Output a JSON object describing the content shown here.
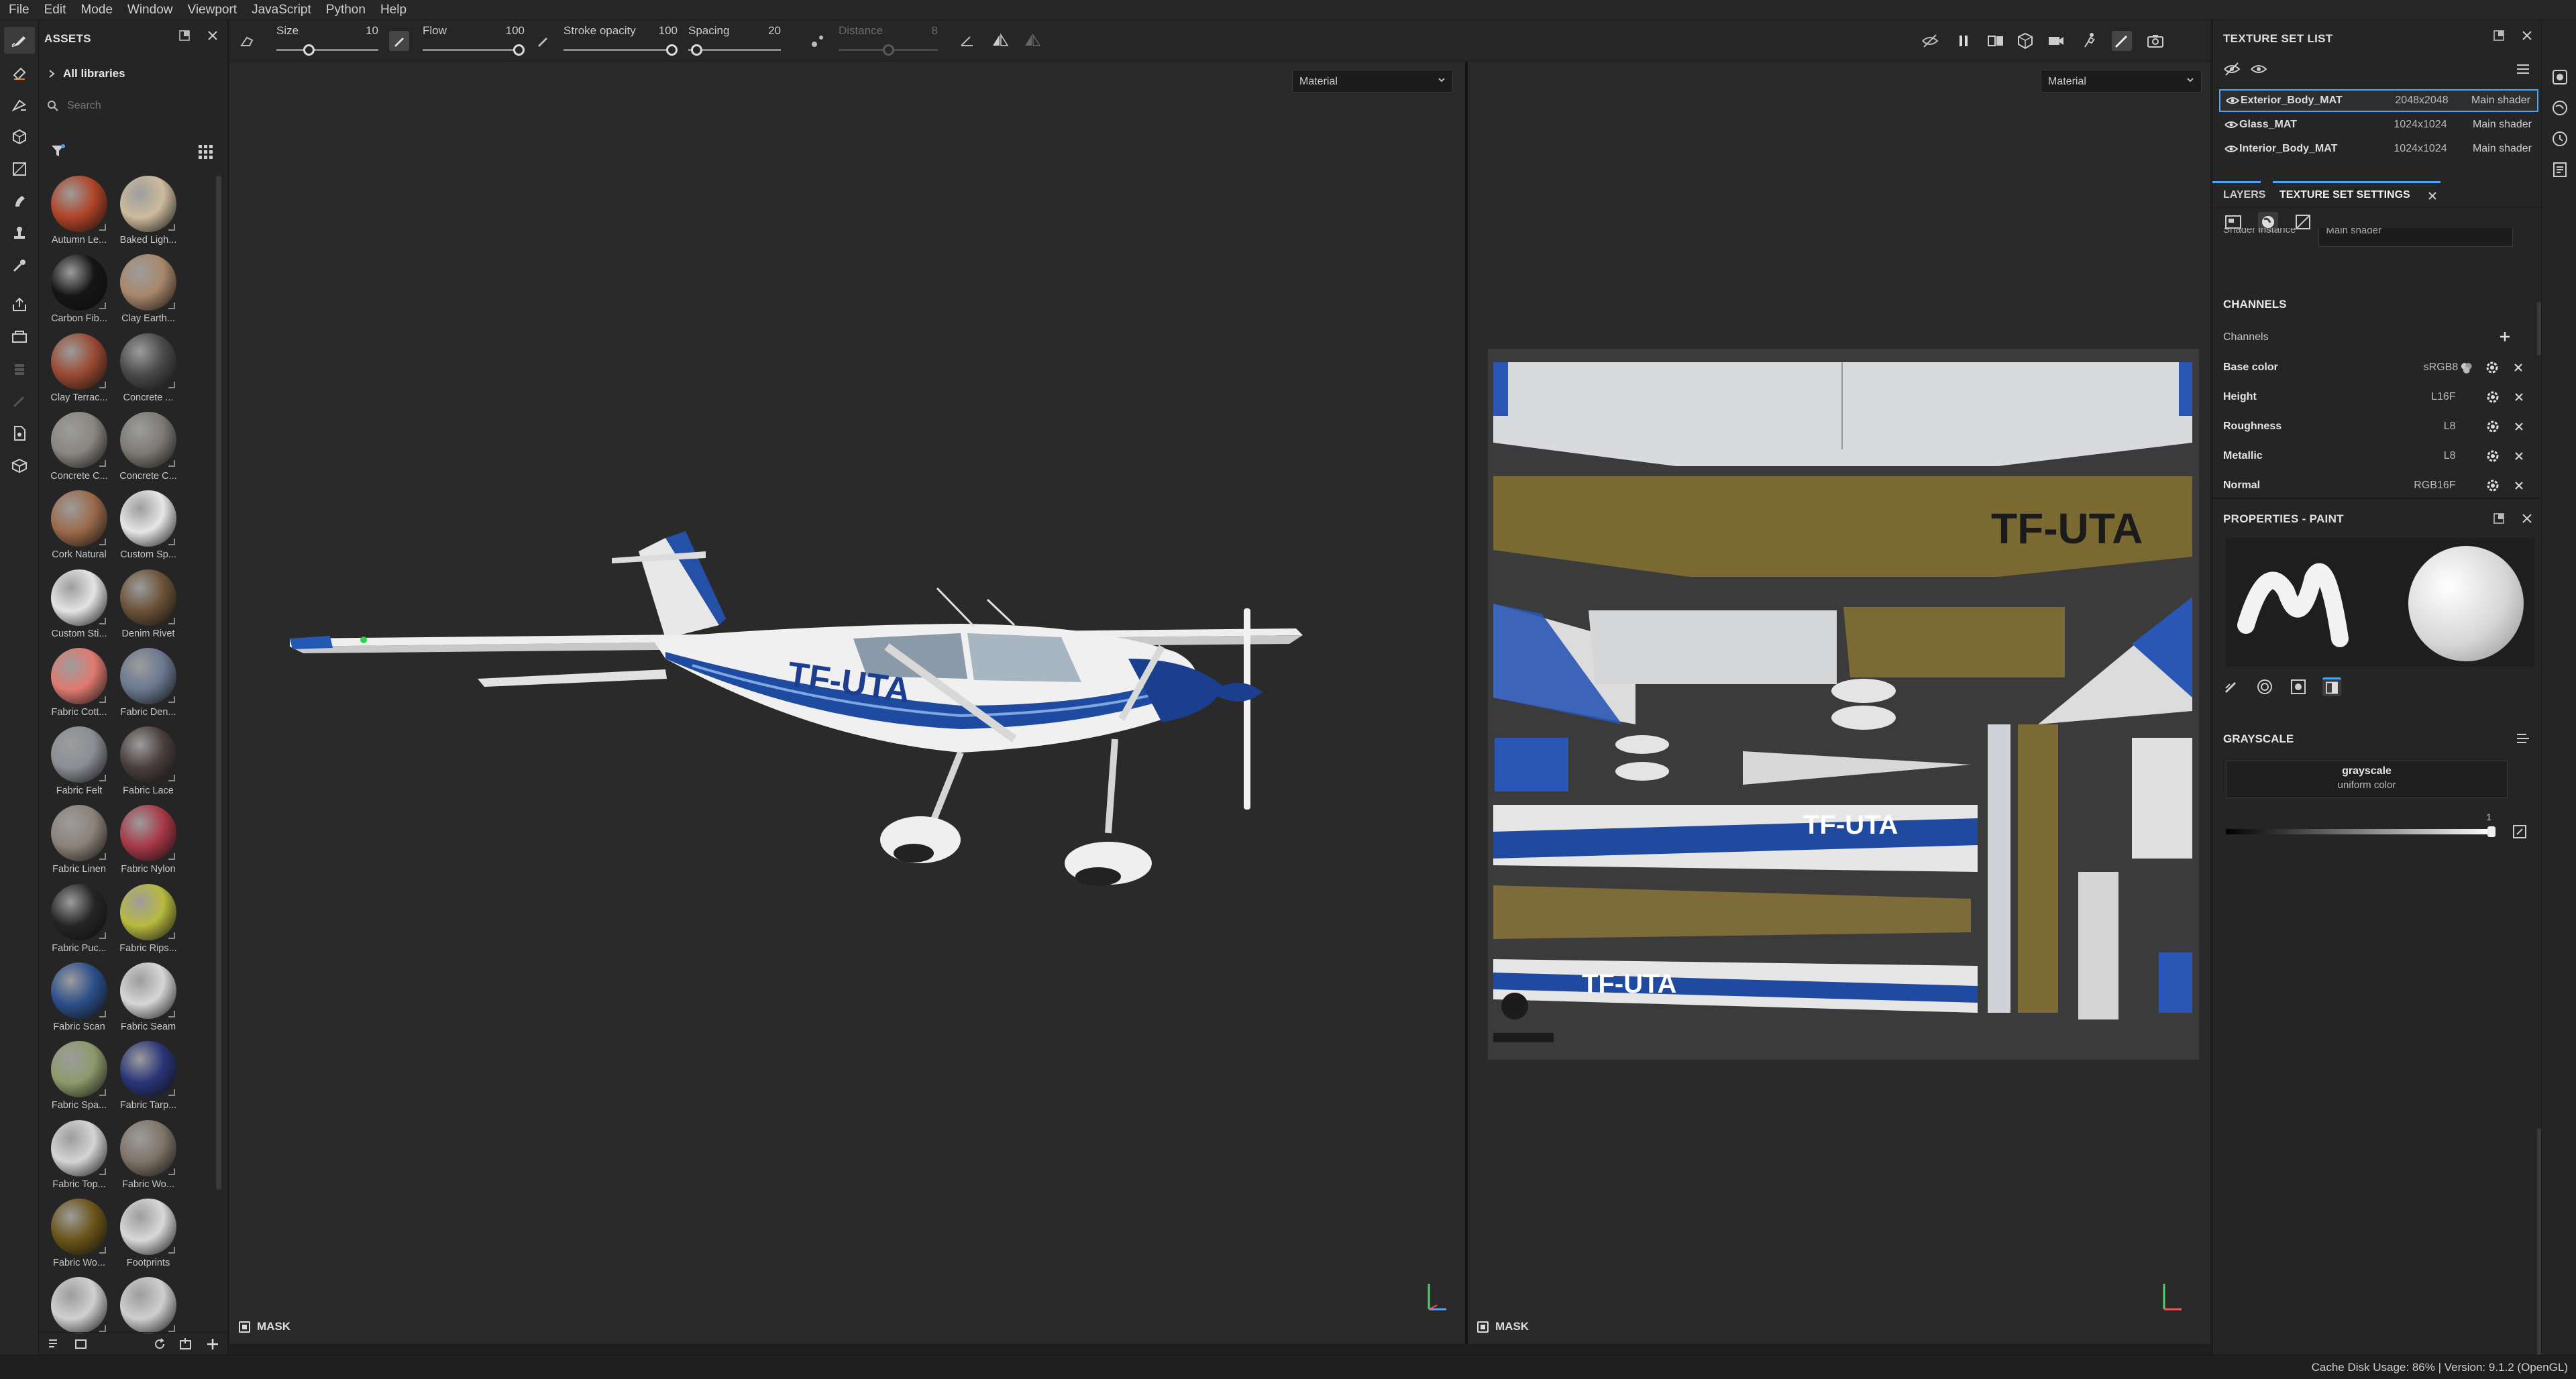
{
  "menu": [
    "File",
    "Edit",
    "Mode",
    "Window",
    "Viewport",
    "JavaScript",
    "Python",
    "Help"
  ],
  "assets": {
    "title": "ASSETS",
    "library": "All libraries",
    "search_placeholder": "Search",
    "items": [
      {
        "label": "Autumn Le...",
        "color": "#b04428"
      },
      {
        "label": "Baked Ligh...",
        "color": "#cdbb9d"
      },
      {
        "label": "Carbon Fib...",
        "color": "#151515"
      },
      {
        "label": "Clay Earth...",
        "color": "#a8876a"
      },
      {
        "label": "Clay Terrac...",
        "color": "#9a4a32"
      },
      {
        "label": "Concrete ...",
        "color": "#4a4a4a"
      },
      {
        "label": "Concrete C...",
        "color": "#8a8680"
      },
      {
        "label": "Concrete C...",
        "color": "#7d7a74"
      },
      {
        "label": "Cork Natural",
        "color": "#9b6a4a"
      },
      {
        "label": "Custom Sp...",
        "color": "#e6e6e6"
      },
      {
        "label": "Custom Sti...",
        "color": "#e4e4e4"
      },
      {
        "label": "Denim Rivet",
        "color": "#6b5238"
      },
      {
        "label": "Fabric Cott...",
        "color": "#e07a70"
      },
      {
        "label": "Fabric Den...",
        "color": "#6a7890"
      },
      {
        "label": "Fabric Felt",
        "color": "#8a8e94"
      },
      {
        "label": "Fabric Lace",
        "color": "#4a3e3e"
      },
      {
        "label": "Fabric Linen",
        "color": "#8c8278"
      },
      {
        "label": "Fabric Nylon",
        "color": "#a83848"
      },
      {
        "label": "Fabric Puc...",
        "color": "#252525"
      },
      {
        "label": "Fabric Rips...",
        "color": "#b8ba40"
      },
      {
        "label": "Fabric Scan",
        "color": "#2c4f8a"
      },
      {
        "label": "Fabric Seam",
        "color": "#d6d6d6"
      },
      {
        "label": "Fabric Spa...",
        "color": "#8e9a6c"
      },
      {
        "label": "Fabric Tarp...",
        "color": "#2a3578"
      },
      {
        "label": "Fabric Top...",
        "color": "#d4d4d4"
      },
      {
        "label": "Fabric Wo...",
        "color": "#807468"
      },
      {
        "label": "Fabric Wo...",
        "color": "#6a5418"
      },
      {
        "label": "Footprints",
        "color": "#d8d8d8"
      },
      {
        "label": "",
        "color": "#d0d0d0"
      },
      {
        "label": "",
        "color": "#cfcfcf"
      }
    ]
  },
  "toolbar": {
    "size_label": "Size",
    "size_value": "10",
    "flow_label": "Flow",
    "flow_value": "100",
    "opacity_label": "Stroke opacity",
    "opacity_value": "100",
    "spacing_label": "Spacing",
    "spacing_value": "20",
    "distance_label": "Distance",
    "distance_value": "8"
  },
  "viewport": {
    "material_left": "Material",
    "material_right": "Material",
    "mask_left": "MASK",
    "mask_right": "MASK",
    "registration": "TF-UTA"
  },
  "texture_set_list": {
    "title": "TEXTURE SET LIST",
    "rows": [
      {
        "name": "Exterior_Body_MAT",
        "res": "2048x2048",
        "shader": "Main shader"
      },
      {
        "name": "Glass_MAT",
        "res": "1024x1024",
        "shader": "Main shader"
      },
      {
        "name": "Interior_Body_MAT",
        "res": "1024x1024",
        "shader": "Main shader"
      }
    ]
  },
  "tabs": {
    "layers": "LAYERS",
    "settings": "TEXTURE SET SETTINGS"
  },
  "settings": {
    "shader_instance_label": "Shader instance",
    "shader_instance_value": "Main shader",
    "channels_title": "CHANNELS",
    "channels_label": "Channels",
    "channels": [
      {
        "name": "Base color",
        "fmt": "sRGB8"
      },
      {
        "name": "Height",
        "fmt": "L16F"
      },
      {
        "name": "Roughness",
        "fmt": "L8"
      },
      {
        "name": "Metallic",
        "fmt": "L8"
      },
      {
        "name": "Normal",
        "fmt": "RGB16F"
      }
    ]
  },
  "properties": {
    "title": "PROPERTIES - PAINT",
    "section": "GRAYSCALE",
    "mode": "grayscale",
    "mode_sub": "uniform color",
    "slider_value": "1"
  },
  "status": "Cache Disk Usage:   86% | Version: 9.1.2 (OpenGL)"
}
